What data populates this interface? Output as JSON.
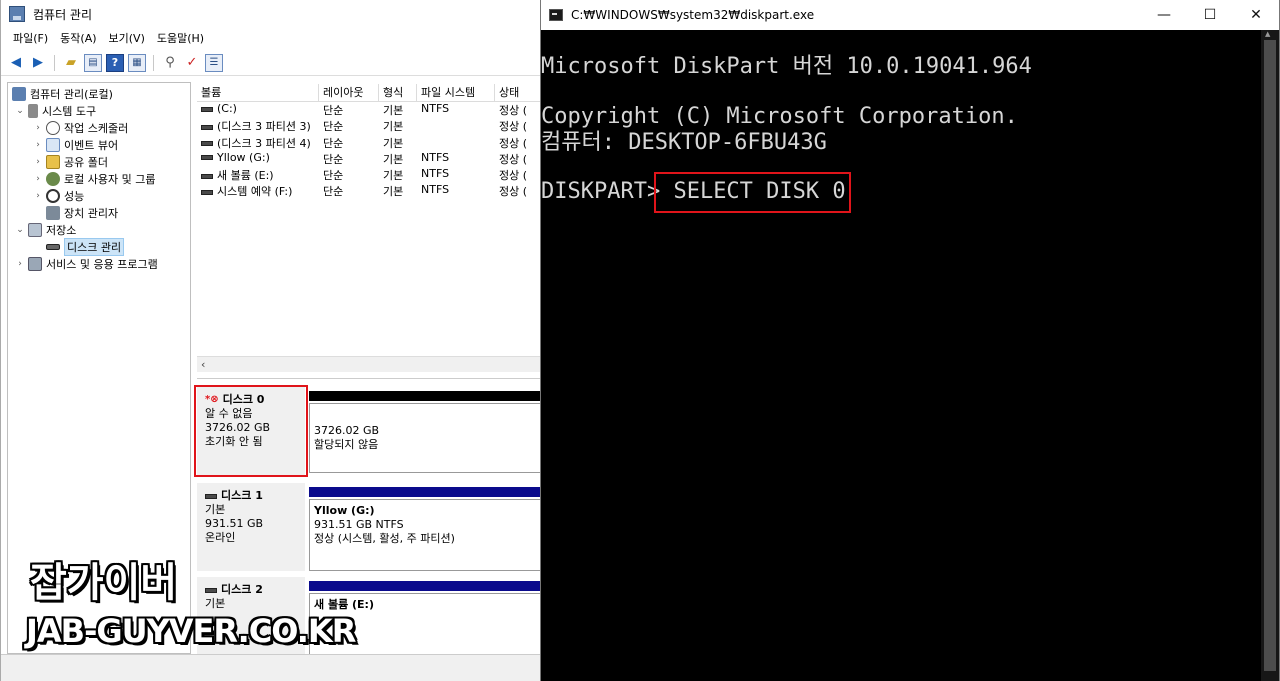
{
  "computer_management": {
    "title": "컴퓨터 관리",
    "menu": [
      "파일(F)",
      "동작(A)",
      "보기(V)",
      "도움말(H)"
    ],
    "toolbar_icons": [
      "back-arrow-icon",
      "forward-arrow-icon",
      "up-folder-icon",
      "show-hide-tree-icon",
      "help-icon",
      "properties-icon",
      "connect-icon",
      "check-icon",
      "settings-icon"
    ],
    "tree": [
      {
        "label": "컴퓨터 관리(로컬)",
        "icon": "computer-management-icon"
      },
      {
        "label": "시스템 도구",
        "icon": "tools-icon"
      },
      {
        "label": "작업 스케줄러",
        "icon": "clock-icon"
      },
      {
        "label": "이벤트 뷰어",
        "icon": "event-viewer-icon"
      },
      {
        "label": "공유 폴더",
        "icon": "shared-folder-icon"
      },
      {
        "label": "로컬 사용자 및 그룹",
        "icon": "users-icon"
      },
      {
        "label": "성능",
        "icon": "performance-icon"
      },
      {
        "label": "장치 관리자",
        "icon": "device-manager-icon"
      },
      {
        "label": "저장소",
        "icon": "storage-icon"
      },
      {
        "label": "디스크 관리",
        "icon": "disk-management-icon"
      },
      {
        "label": "서비스 및 응용 프로그램",
        "icon": "services-icon"
      }
    ],
    "volume_columns": [
      "볼륨",
      "레이아웃",
      "형식",
      "파일 시스템",
      "상태"
    ],
    "volumes": [
      {
        "name": "(C:)",
        "layout": "단순",
        "type": "기본",
        "fs": "NTFS",
        "status": "정상 ("
      },
      {
        "name": "(디스크 3 파티션 3)",
        "layout": "단순",
        "type": "기본",
        "fs": "",
        "status": "정상 ("
      },
      {
        "name": "(디스크 3 파티션 4)",
        "layout": "단순",
        "type": "기본",
        "fs": "",
        "status": "정상 ("
      },
      {
        "name": "Yllow (G:)",
        "layout": "단순",
        "type": "기본",
        "fs": "NTFS",
        "status": "정상 ("
      },
      {
        "name": "새 볼륨 (E:)",
        "layout": "단순",
        "type": "기본",
        "fs": "NTFS",
        "status": "정상 ("
      },
      {
        "name": "시스템 예약 (F:)",
        "layout": "단순",
        "type": "기본",
        "fs": "NTFS",
        "status": "정상 ("
      }
    ],
    "disks": [
      {
        "name": "디스크 0",
        "line1": "알 수 없음",
        "line2": "3726.02 GB",
        "line3": "초기화 안 됨",
        "part_title": "",
        "part_line1": "3726.02 GB",
        "part_line2": "할당되지 않음"
      },
      {
        "name": "디스크 1",
        "line1": "기본",
        "line2": "931.51 GB",
        "line3": "온라인",
        "part_title": "Yllow  (G:)",
        "part_line1": "931.51 GB NTFS",
        "part_line2": "정상 (시스템, 활성, 주 파티션)"
      },
      {
        "name": "디스크 2",
        "line1": "기본",
        "line2": "",
        "line3": "",
        "part_title": "새 볼륨  (E:)",
        "part_line1": "",
        "part_line2": ""
      }
    ],
    "highlight_color": "#e0141a"
  },
  "console": {
    "title": "C:₩WINDOWS₩system32₩diskpart.exe",
    "lines": [
      "Microsoft DiskPart 버전 10.0.19041.964",
      "Copyright (C) Microsoft Corporation.",
      "컴퓨터: DESKTOP-6FBU43G"
    ],
    "prompt": "DISKPART> ",
    "command": "SELECT DISK 0",
    "minimize_glyph": "—",
    "maximize_glyph": "☐",
    "close_glyph": "✕"
  },
  "watermark": {
    "korean": "잡가이버",
    "url": "JAB-GUYVER.CO.KR"
  }
}
